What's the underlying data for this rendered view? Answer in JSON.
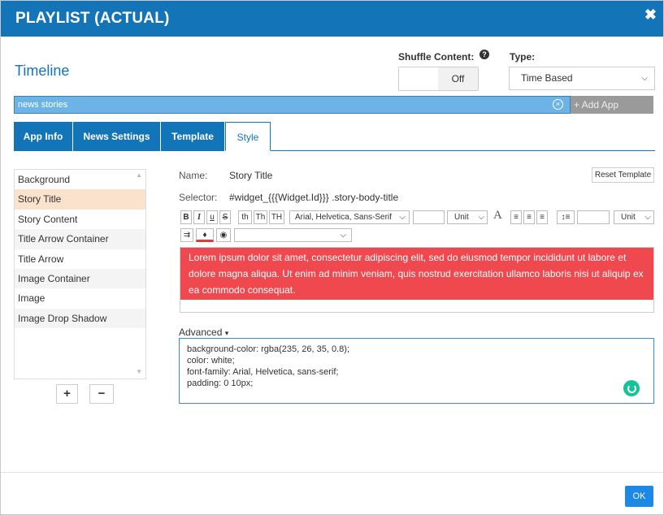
{
  "dialog": {
    "title": "PLAYLIST (ACTUAL)",
    "close_icon": "close-icon"
  },
  "timeline": {
    "heading": "Timeline"
  },
  "shuffle": {
    "label": "Shuffle Content:",
    "help": "?",
    "state": "Off"
  },
  "type": {
    "label": "Type:",
    "selected": "Time Based"
  },
  "search": {
    "value": "news stories",
    "clear": "×",
    "add_app": "+ Add App"
  },
  "tabs": [
    {
      "label": "App Info"
    },
    {
      "label": "News Settings"
    },
    {
      "label": "Template"
    },
    {
      "label": "Style",
      "active": true
    }
  ],
  "elements": [
    "Background",
    "Story Title",
    "Story Content",
    "Title Arrow Container",
    "Title Arrow",
    "Image Container",
    "Image",
    "Image Drop Shadow"
  ],
  "selected_element": "Story Title",
  "list_buttons": {
    "add": "+",
    "remove": "−"
  },
  "style": {
    "name_label": "Name:",
    "name_value": "Story Title",
    "reset_button": "Reset Template",
    "selector_label": "Selector:",
    "selector_value": "#widget_{{{Widget.Id}}} .story-body-title"
  },
  "toolbar": {
    "bold": "B",
    "italic": "I",
    "underline": "u",
    "strike": "S",
    "th_lower": "th",
    "th_title": "Th",
    "th_upper": "TH",
    "font_family": "Arial, Helvetica, Sans-Serif",
    "size_unit": "Unit",
    "line_height_unit": "Unit",
    "font_glyph": "A"
  },
  "preview_text": "Lorem ipsum dolor sit amet, consectetur adipiscing elit, sed do eiusmod tempor incididunt ut labore et dolore magna aliqua. Ut enim ad minim veniam, quis nostrud exercitation ullamco laboris nisi ut aliquip ex ea commodo consequat.",
  "advanced": {
    "label": "Advanced",
    "css_lines": [
      "background-color: rgba(235, 26, 35, 0.8);",
      "color: white;",
      "font-family: Arial, Helvetica, sans-serif;",
      "padding: 0 10px;"
    ]
  },
  "footer": {
    "ok": "OK"
  },
  "colors": {
    "brand": "#1474b8",
    "preview_bg": "rgba(235, 26, 35, 0.8)",
    "selected_row": "#fbe2cd",
    "ok_button": "#1e88e5"
  }
}
